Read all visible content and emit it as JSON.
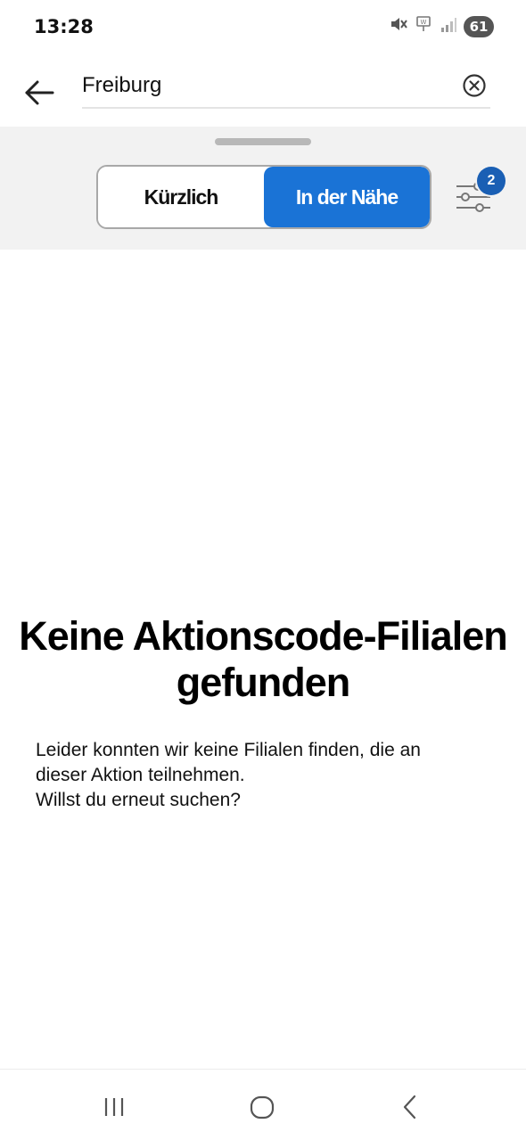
{
  "status_bar": {
    "time": "13:28",
    "battery": "61",
    "icons": [
      "mute-icon",
      "wifi-calling-icon",
      "signal-icon",
      "battery-icon"
    ]
  },
  "search": {
    "value": "Freiburg",
    "placeholder": "",
    "back_icon": "arrow-left-icon",
    "clear_icon": "close-circle-icon"
  },
  "filter": {
    "segments": [
      "Kürzlich",
      "In der Nähe"
    ],
    "active_segment": "In der Nähe",
    "filter_icon": "sliders-icon",
    "badge_count": "2"
  },
  "empty_state": {
    "title": "Keine Aktionscode-Filialen gefunden",
    "lines": [
      "Leider konnten wir keine Filialen finden, die an",
      "dieser Aktion teilnehmen.",
      "Willst du erneut suchen?"
    ]
  },
  "nav": {
    "icons": [
      "recent-apps-icon",
      "home-icon",
      "back-icon"
    ]
  },
  "colors": {
    "accent": "#1a73d6",
    "badge": "#1a5fb4",
    "panel_bg": "#f2f2f2"
  }
}
